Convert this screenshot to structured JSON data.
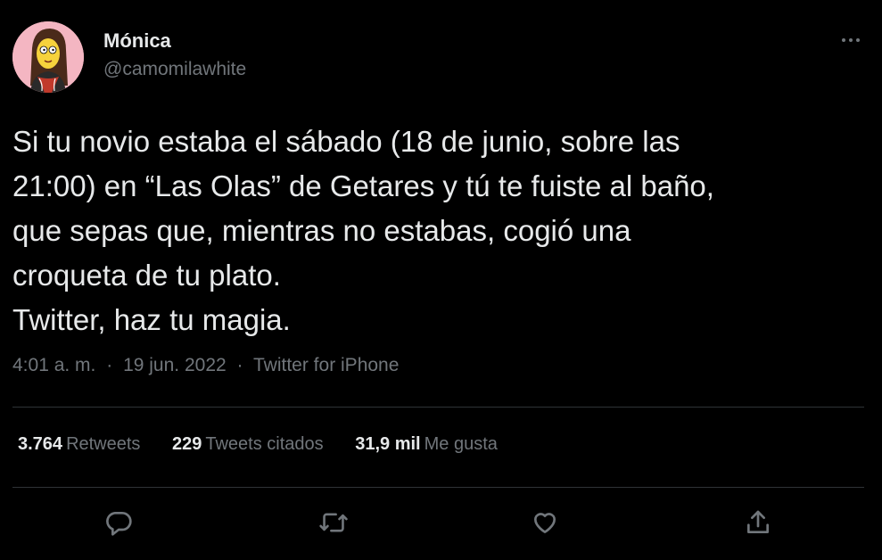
{
  "tweet": {
    "author": {
      "display_name": "Mónica",
      "handle": "@camomilawhite"
    },
    "text_lines": [
      "Si tu novio estaba el sábado (18 de junio, sobre las",
      "21:00) en “Las Olas” de Getares y tú te fuiste al baño,",
      "que sepas que, mientras no estabas, cogió una",
      "croqueta de tu plato.",
      "Twitter, haz tu magia."
    ],
    "meta": {
      "time": "4:01 a. m.",
      "date": "19 jun. 2022",
      "source": "Twitter for iPhone",
      "separator": "·"
    },
    "stats": {
      "retweets": {
        "count": "3.764",
        "label": "Retweets"
      },
      "quotes": {
        "count": "229",
        "label": "Tweets citados"
      },
      "likes": {
        "count": "31,9 mil",
        "label": "Me gusta"
      }
    },
    "actions": [
      "reply-icon",
      "retweet-icon",
      "like-icon",
      "share-icon"
    ],
    "more_icon": "more-dots-icon"
  },
  "colors": {
    "background": "#000000",
    "primary_text": "#e7e9ea",
    "secondary_text": "#71767b",
    "divider": "#2f3336"
  }
}
